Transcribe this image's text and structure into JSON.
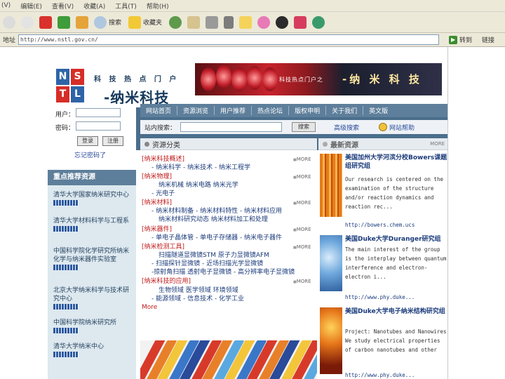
{
  "browser": {
    "menu": [
      "(V)",
      "编辑(E)",
      "查看(V)",
      "收藏(A)",
      "工具(T)",
      "帮助(H)"
    ],
    "toolbar": {
      "search_label": "搜索",
      "favorites_label": "收藏夹"
    },
    "address_label": "地址",
    "address_value": "http://www.nstl.gov.cn/",
    "go_label": "转到",
    "links_label": "链接"
  },
  "header": {
    "logo_letters": [
      "N",
      "S",
      "T",
      "L"
    ],
    "tagline": "科 技 热 点 门 户",
    "site_title": "-纳米科技",
    "banner_small": "科技热点门户之",
    "banner_big": "-纳 米 科 技"
  },
  "nav": [
    "网站首页",
    "资源浏览",
    "用户推荐",
    "热点论坛",
    "版权申明",
    "关于我们",
    "英文版"
  ],
  "search": {
    "label": "站内搜索：",
    "button": "搜索",
    "advanced": "高级搜索",
    "help": "网站帮助"
  },
  "login": {
    "user_label": "用户：",
    "password_label": "密码：",
    "login_button": "登录",
    "register_button": "注册",
    "forgot": "忘记密码了"
  },
  "featured": {
    "title": "重点推荐资源",
    "items": [
      "清华大学国家纳米研究中心",
      "清华大学材料科学与工程系",
      "中国科学院化学研究所纳米化学与纳米器件实验室",
      "北京大学纳米科学与技术研究中心",
      "中国科学院纳米研究所",
      "清华大学纳米中心"
    ]
  },
  "categories": {
    "title": "资源分类",
    "more": "MORE",
    "groups": [
      {
        "name": "[纳米科技概述]",
        "lines": [
          "- 纳米科学 - 纳米技术 - 纳米工程学"
        ]
      },
      {
        "name": "[纳米物理]",
        "lines": [
          "纳米机械 纳米电路 纳米光学",
          "- 光电子"
        ]
      },
      {
        "name": "[纳米材料]",
        "lines": [
          "- 纳米材料制备 - 纳米材料特性 - 纳米材料应用",
          "纳米材料研究动态 纳米材料加工和处理"
        ]
      },
      {
        "name": "[纳米器件]",
        "lines": [
          "- 单电子晶体管 - 单电子存储器 - 纳米电子器件"
        ]
      },
      {
        "name": "[纳米检测工具]",
        "lines": [
          "扫描隧道显微镜STM 原子力显微镜AFM",
          "- 扫描探针显微镜 - 近场扫描光学显微镜",
          "-掠射角扫描 透射电子显微镜 - 高分辨率电子显微镜"
        ]
      },
      {
        "name": "[纳米科技的应用]",
        "lines": [
          "生物领域 医学领域 环境领域",
          "- 能源领域 - 信息技术 - 化学工业"
        ]
      }
    ],
    "more_bottom": "More"
  },
  "latest": {
    "title": "最新资源",
    "more": "MORE",
    "items": [
      {
        "title": "美国加州大学河滨分校Bowers课题组研究组",
        "desc": "Our research is centered on the examination of the structure and/or reaction dynamics and reaction rec...",
        "url": "http://bowers.chem.ucs"
      },
      {
        "title": "美国Duke大学Duranger研究组",
        "desc": "The main interest of the group is the interplay between quantum interference and electron-electron i...",
        "url": "http://www.phy.duke..."
      },
      {
        "title": "美国Duke大学电子纳米结构研究组",
        "desc": "Project: Nanotubes and Nanowires We study electrical properties of carbon nanotubes and other",
        "url": "http://www.phy.duke..."
      }
    ]
  },
  "colors": {
    "accent_blue": "#5e7f9b",
    "header_blue": "#4a6e8c",
    "category_red": "#c01818",
    "link_blue": "#1a3a7a"
  }
}
